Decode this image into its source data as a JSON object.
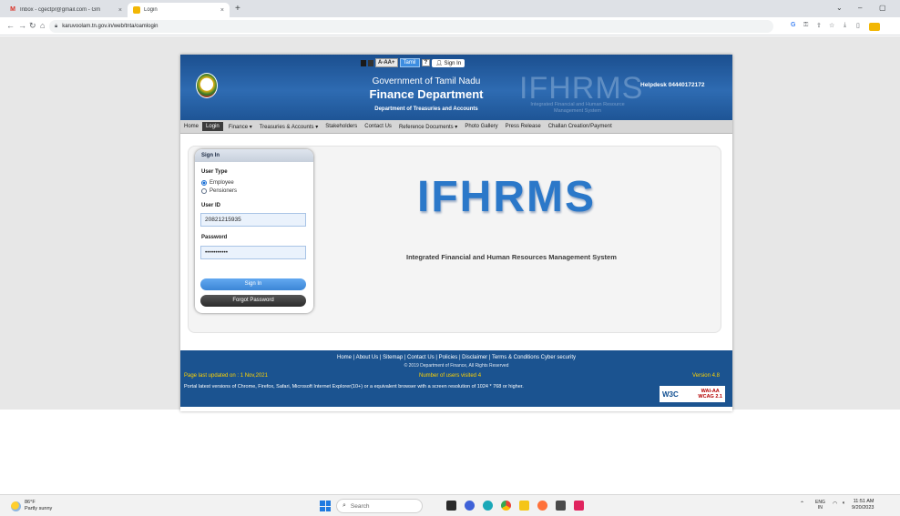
{
  "browser": {
    "tabs": [
      {
        "title": "Inbox - cgectpr@gmail.com - Gm",
        "icon": "gmail-icon"
      },
      {
        "title": "Login",
        "icon": "site-icon"
      }
    ],
    "new_tab_glyph": "+",
    "window_controls": [
      "⌄",
      "–",
      "▢"
    ],
    "url": "karuvoolam.tn.gov.in/web/tnta/oamlogin"
  },
  "site": {
    "accessibility": {
      "font_sizes": "A-AA+",
      "language": "Tamil",
      "help": "?",
      "signin": "Sign In"
    },
    "header": {
      "gov_line": "Government of Tamil Nadu",
      "dept_line": "Finance Department",
      "sub_line": "Department of Treasuries and Accounts",
      "ghost_logo": "IFHRMS",
      "ghost_sub": "Integrated Financial and Human Resource Management System",
      "helpdesk": "Helpdesk  04440172172"
    },
    "menu": [
      {
        "label": "Home",
        "active": false
      },
      {
        "label": "Login",
        "active": true
      },
      {
        "label": "Finance ▾",
        "active": false
      },
      {
        "label": "Treasuries & Accounts ▾",
        "active": false
      },
      {
        "label": "Stakeholders",
        "active": false
      },
      {
        "label": "Contact Us",
        "active": false
      },
      {
        "label": "Reference Documents ▾",
        "active": false
      },
      {
        "label": "Photo Gallery",
        "active": false
      },
      {
        "label": "Press Release",
        "active": false
      },
      {
        "label": "Challan Creation/Payment",
        "active": false
      }
    ],
    "login": {
      "title": "Sign In",
      "user_type_label": "User Type",
      "options": [
        {
          "label": "Employee",
          "selected": true
        },
        {
          "label": "Pensioners",
          "selected": false
        }
      ],
      "userid_label": "User ID",
      "userid_value": "20821215935",
      "password_label": "Password",
      "password_value": "•••••••••••",
      "signin_button": "Sign In",
      "forgot_button": "Forgot Password"
    },
    "hero": {
      "title": "IFHRMS",
      "subtitle": "Integrated Financial and Human Resources Management System"
    },
    "footer": {
      "links": "Home  |  About Us  |  Sitemap  |  Contact Us  |  Policies  |  Disclaimer  |  Terms & Conditions   Cyber security",
      "copyright": "© 2019 Department of Finance, All Rights Reserved",
      "updated": "Page last updated on : 1 Nov,2021",
      "visitors": "Number of users visited 4",
      "version": "Version 4.8",
      "note": "Portal latest versions of Chrome, Firefox, Safari, Microsoft Internet Explorer(10+) or a equivalent browser with a screen resolution of 1024 * 768 or higher.",
      "w3c": "W3C",
      "wai": "WAI-AA",
      "wcag": "WCAG 2.1"
    }
  },
  "taskbar": {
    "weather_temp": "86°F",
    "weather_desc": "Partly sunny",
    "search_placeholder": "Search",
    "lang": "ENG",
    "lang_region": "IN",
    "time": "11:51 AM",
    "date": "9/20/2023"
  },
  "colors": {
    "header_blue": "#1b4f8f",
    "footer_blue": "#1b5390",
    "accent_blue": "#2b78c9",
    "footer_yellow": "#ffd200"
  }
}
